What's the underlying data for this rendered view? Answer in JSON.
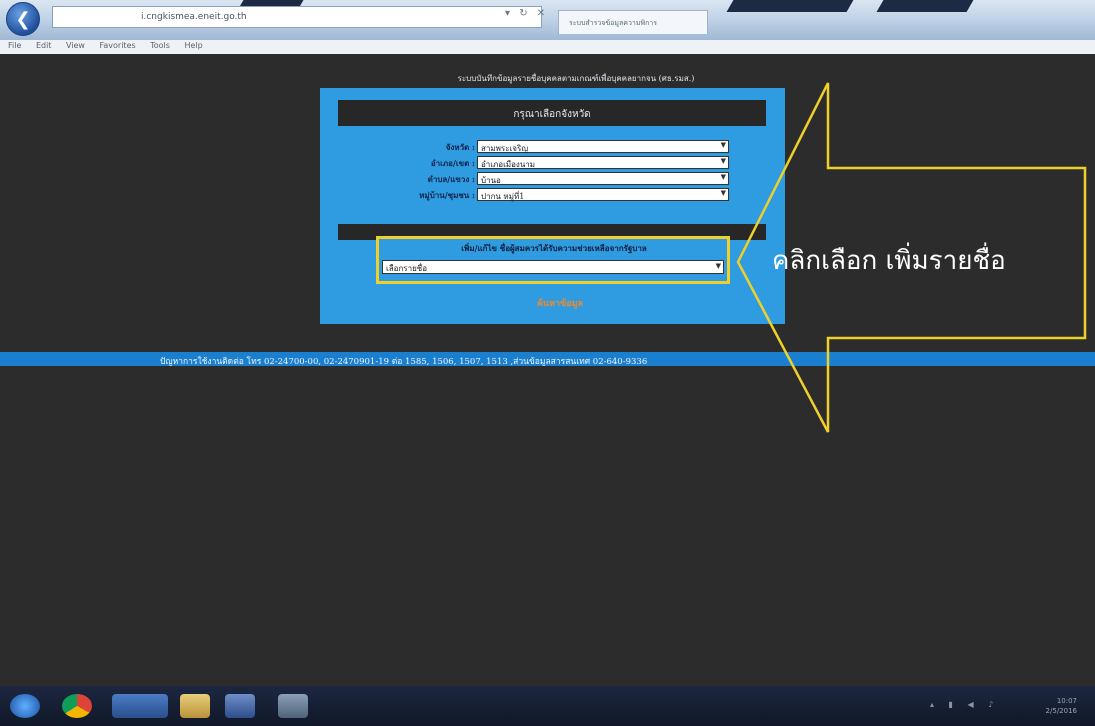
{
  "browser": {
    "back_icon": "back-arrow-icon",
    "back_glyph": "❮",
    "address": "i.cngkismea.eneit.go.th",
    "addr_controls": "▾ ↻ ✕",
    "tab_title": "ระบบสำรวจข้อมูลความพิการ",
    "menu": [
      "File",
      "Edit",
      "View",
      "Favorites",
      "Tools",
      "Help"
    ]
  },
  "page": {
    "heading": "ระบบบันทึกข้อมูลรายชื่อบุคคลตามเกณฑ์เพื่อบุคคลยากจน (ศธ.รมส.)",
    "form_title": "กรุณาเลือกจังหวัด",
    "fields": [
      {
        "label": "จังหวัด :",
        "value": "สามพระเจริญ"
      },
      {
        "label": "อำเภอ/เขต :",
        "value": "อำเภอเมืองนาม"
      },
      {
        "label": "ตำบล/แขวง :",
        "value": "บ้านอ"
      },
      {
        "label": "หมู่บ้าน/ชุมชน :",
        "value": "ปากน หมู่ที่1"
      }
    ],
    "add_label": "เพิ่ม/แก้ไข ชื่อผู้สมควรได้รับความช่วยเหลือจากรัฐบาล",
    "add_select_value": "เลือกรายชื่อ",
    "submit_text": "ค้นหาข้อมูล",
    "info_text": "ปัญหาการใช้งานติดต่อ โทร 02-24700-00, 02-2470901-19 ต่อ 1585, 1506, 1507, 1513 ,ส่วนข้อมูลสารสนเทศ 02-640-9336"
  },
  "annotation": {
    "text": "คลิกเลือก เพิ่มรายชื่อ",
    "color": "#efd02b"
  },
  "taskbar": {
    "items": [
      "start-orb-icon",
      "chrome-icon",
      "internet-explorer-icon",
      "folder-icon",
      "word-icon",
      "messenger-icon"
    ],
    "tray": "▴ ▮ ◀ ♪",
    "clock_time": "10:07",
    "clock_date": "2/5/2016"
  },
  "colors": {
    "page_bg": "#2b2c2b",
    "panel": "#2f9be0",
    "info_bar": "#1b7fd0",
    "highlight": "#efd02b"
  }
}
